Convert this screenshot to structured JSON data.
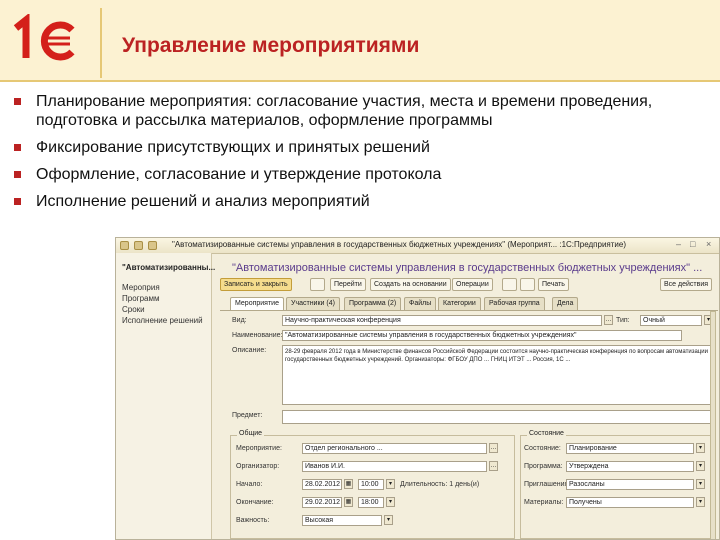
{
  "header": {
    "title": "Управление мероприятиями",
    "logo_text": "1С"
  },
  "bullets": [
    "Планирование мероприятия: согласование участия, места и времени проведения, подготовка и рассылка материалов, оформление программы",
    "Фиксирование присутствующих и принятых решений",
    "Оформление, согласование и утверждение протокола",
    "Исполнение решений и анализ мероприятий"
  ],
  "window": {
    "title": "\"Автоматизированные системы управления в государственных бюджетных учреждениях\" (Мероприят... :1С:Предприятие)",
    "left_panel": {
      "heading": "\"Автоматизированны...",
      "items": [
        "Мероприя",
        "Программ",
        "Сроки",
        "Исполнение решений"
      ]
    },
    "doc_title": "\"Автоматизированные системы управления в государственных бюджетных учреждениях\" ...",
    "toolbar": {
      "save_close": "Записать и закрыть",
      "b2": "Перейти",
      "b3": "Создать на основании",
      "b4": "Операции",
      "b5": "Печать",
      "more": "Все действия"
    },
    "tabs": [
      "Мероприятие",
      "Участники (4)",
      "Программа (2)",
      "Файлы",
      "Категории",
      "Рабочая группа",
      "Дела"
    ],
    "form": {
      "vid_label": "Вид:",
      "vid_value": "Научно-практическая конференция",
      "type_label": "Тип:",
      "type_value": "Очный",
      "name_label": "Наименование:",
      "name_value": "\"Автоматизированные системы управления в государственных бюджетных учреждениях\"",
      "desc_label": "Описание:",
      "desc_value": "28-29 февраля 2012 года в Министерстве финансов Российской Федерации состоится научно-практическая конференция по вопросам автоматизации государственных бюджетных учреждений. Организаторы: ФГБОУ ДПО ... ГНИЦ ИТЭТ ... Россия, 1С ...",
      "subject_label": "Предмет:",
      "subject_value": "",
      "general_group": "Общие",
      "org_label": "Мероприятие:",
      "org_value": "Отдел регионального ...",
      "organizer_label": "Организатор:",
      "organizer_value": "Иванов И.И.",
      "start_label": "Начало:",
      "start_date": "28.02.2012",
      "start_time": "10:00",
      "duration_text": "Длительность: 1 день(и)",
      "end_label": "Окончание:",
      "end_date": "29.02.2012",
      "end_time": "18:00",
      "importance_label": "Важность:",
      "importance_value": "Высокая",
      "state_group": "Состояние",
      "status_label": "Состояние:",
      "status_value": "Планирование",
      "program_label": "Программа:",
      "program_value": "Утверждена",
      "invites_label": "Приглашения:",
      "invites_value": "Разосланы",
      "materials_label": "Материалы:",
      "materials_value": "Получены"
    }
  }
}
